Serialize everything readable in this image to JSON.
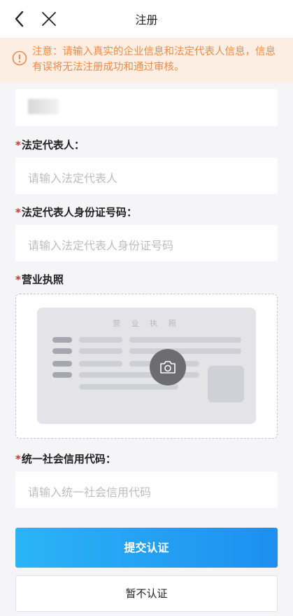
{
  "nav": {
    "title": "注册",
    "back_icon": "chevron-left-icon",
    "close_icon": "close-icon"
  },
  "notice": {
    "icon": "info-circle-icon",
    "text": "注意：请输入真实的企业信息和法定代表人信息，信息有误将无法注册成功和通过审核。",
    "color": "#ef8a47",
    "background": "#fdeee3"
  },
  "fields": {
    "company": {
      "value_obscured": true
    },
    "legal_rep": {
      "required_mark": "*",
      "label": "法定代表人：",
      "placeholder": "请输入法定代表人"
    },
    "legal_rep_id": {
      "required_mark": "*",
      "label": "法定代表人身份证号码：",
      "placeholder": "请输入法定代表人身份证号码"
    },
    "business_license": {
      "required_mark": "*",
      "label": "营业执照",
      "illustration_title": "营 业 执 照",
      "upload_icon": "camera-icon"
    },
    "credit_code": {
      "required_mark": "*",
      "label": "统一社会信用代码：",
      "placeholder": "请输入统一社会信用代码"
    }
  },
  "actions": {
    "submit_label": "提交认证",
    "skip_label": "暂不认证"
  },
  "colors": {
    "primary_start": "#2bb4f6",
    "primary_end": "#1d8ff0",
    "required": "#e0282a"
  }
}
